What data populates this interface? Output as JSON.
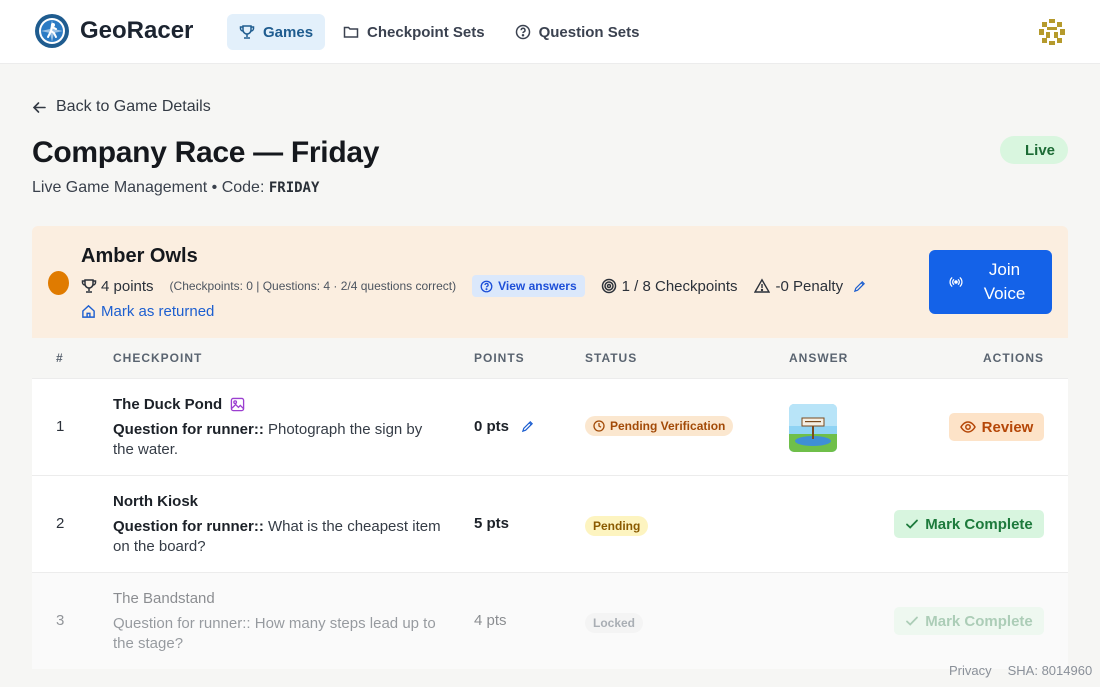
{
  "header": {
    "brand": "GeoRacer",
    "nav": [
      {
        "label": "Games",
        "active": true
      },
      {
        "label": "Checkpoint Sets",
        "active": false
      },
      {
        "label": "Question Sets",
        "active": false
      }
    ]
  },
  "back_label": "Back to Game Details",
  "game": {
    "title": "Company Race — Friday",
    "subtitle": "Live Game Management • Code: ",
    "code": "FRIDAY",
    "status": "Live"
  },
  "team": {
    "name": "Amber Owls",
    "color": "#e07b00",
    "points": "4 points",
    "breakdown": "(Checkpoints: 0 | Questions: 4 · 2/4 questions correct)",
    "view_answers": "View answers",
    "checkpoints": "1 / 8 Checkpoints",
    "penalty": "-0 Penalty",
    "mark_returned": "Mark as returned",
    "join_voice": "Join Voice"
  },
  "table": {
    "headers": {
      "num": "#",
      "checkpoint": "CHECKPOINT",
      "points": "POINTS",
      "status": "STATUS",
      "answer": "ANSWER",
      "actions": "ACTIONS"
    },
    "rows": [
      {
        "num": "1",
        "title": "The Duck Pond",
        "question_prefix": "Question for runner::",
        "question": " Photograph the sign by the water.",
        "points": "0 pts",
        "status": "Pending Verification",
        "action": "Review"
      },
      {
        "num": "2",
        "title": "North Kiosk",
        "question_prefix": "Question for runner::",
        "question": " What is the cheapest item on the board?",
        "points": "5 pts",
        "status": "Pending",
        "action": "Mark Complete"
      },
      {
        "num": "3",
        "title": "The Bandstand",
        "question_prefix": "Question for runner::",
        "question": " How many steps lead up to the stage?",
        "points": "4 pts",
        "status": "Locked",
        "action": "Mark Complete"
      }
    ]
  },
  "footer": {
    "privacy": "Privacy",
    "sha": "SHA: 8014960"
  },
  "colors": {
    "accent": "#1462e8",
    "live": "#1c6b35",
    "team_panel": "#fbeee0"
  }
}
